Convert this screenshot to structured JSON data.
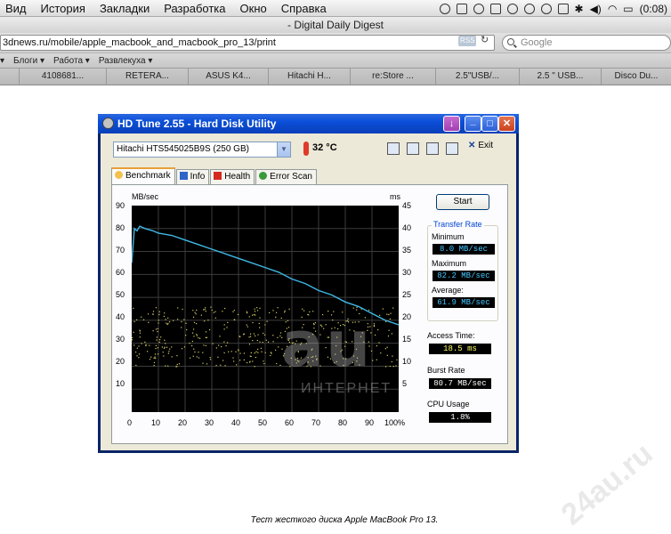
{
  "menubar": {
    "items": [
      "Вид",
      "История",
      "Закладки",
      "Разработка",
      "Окно",
      "Справка"
    ],
    "clock": "(0:08)"
  },
  "window": {
    "title": "- Digital Daily Digest"
  },
  "address": {
    "url": "3dnews.ru/mobile/apple_macbook_and_macbook_pro_13/print",
    "rss": "RSS",
    "search_placeholder": "Google"
  },
  "bookmarks": [
    "▾",
    "Блоги ▾",
    "Работа ▾",
    "Развлекуха ▾"
  ],
  "tabs": [
    "4108681...",
    "RETERA...",
    "ASUS K4...",
    "Hitachi H...",
    "re:Store ...",
    "2.5\"USB/...",
    "2.5 \" USB...",
    "Disco Du..."
  ],
  "hdtune": {
    "title": "HD Tune 2.55 - Hard Disk Utility",
    "drive": "Hitachi HTS545025B9S (250 GB)",
    "temperature": "32 °C",
    "exit_label": "Exit",
    "tabs": [
      "Benchmark",
      "Info",
      "Health",
      "Error Scan"
    ],
    "start_label": "Start",
    "transfer_rate_label": "Transfer Rate",
    "minimum_label": "Minimum",
    "minimum_value": "8.0 MB/sec",
    "maximum_label": "Maximum",
    "maximum_value": "82.2 MB/sec",
    "average_label": "Average:",
    "average_value": "61.9 MB/sec",
    "access_label": "Access Time:",
    "access_value": "18.5 ms",
    "burst_label": "Burst Rate",
    "burst_value": "80.7 MB/sec",
    "cpu_label": "CPU Usage",
    "cpu_value": "1.8%",
    "unit_left": "MB/sec",
    "unit_right": "ms"
  },
  "chart_data": {
    "type": "line",
    "y_left_label": "MB/sec",
    "y_right_label": "ms",
    "yticks_left": [
      "90",
      "80",
      "70",
      "60",
      "50",
      "40",
      "30",
      "20",
      "10"
    ],
    "yticks_right": [
      "45",
      "40",
      "35",
      "30",
      "25",
      "20",
      "15",
      "10",
      "5"
    ],
    "xticks": [
      "0",
      "10",
      "20",
      "30",
      "40",
      "50",
      "60",
      "70",
      "80",
      "90",
      "100%"
    ],
    "ylim_left": [
      0,
      90
    ],
    "ylim_right": [
      0,
      45
    ],
    "xlim": [
      0,
      100
    ],
    "grid": true,
    "series": [
      {
        "x": [
          0,
          1,
          2,
          3,
          5,
          8,
          10,
          15,
          20,
          25,
          30,
          35,
          40,
          45,
          50,
          55,
          60,
          65,
          70,
          75,
          80,
          85,
          90,
          95,
          100
        ],
        "values": [
          65,
          80,
          79,
          81,
          80,
          79,
          78,
          77,
          75,
          73,
          71,
          69,
          67,
          65,
          63,
          61,
          58,
          56,
          53,
          51,
          48,
          46,
          43,
          40,
          38
        ]
      }
    ],
    "access_scatter_range_ms": [
      10,
      23
    ]
  },
  "colors": {
    "plot_bg": "#000000",
    "line": "#3fb8e6",
    "scatter": "#d8d060",
    "grid": "#3c3c3c"
  },
  "caption": "Тест жесткого диска Apple MacBook Pro 13."
}
